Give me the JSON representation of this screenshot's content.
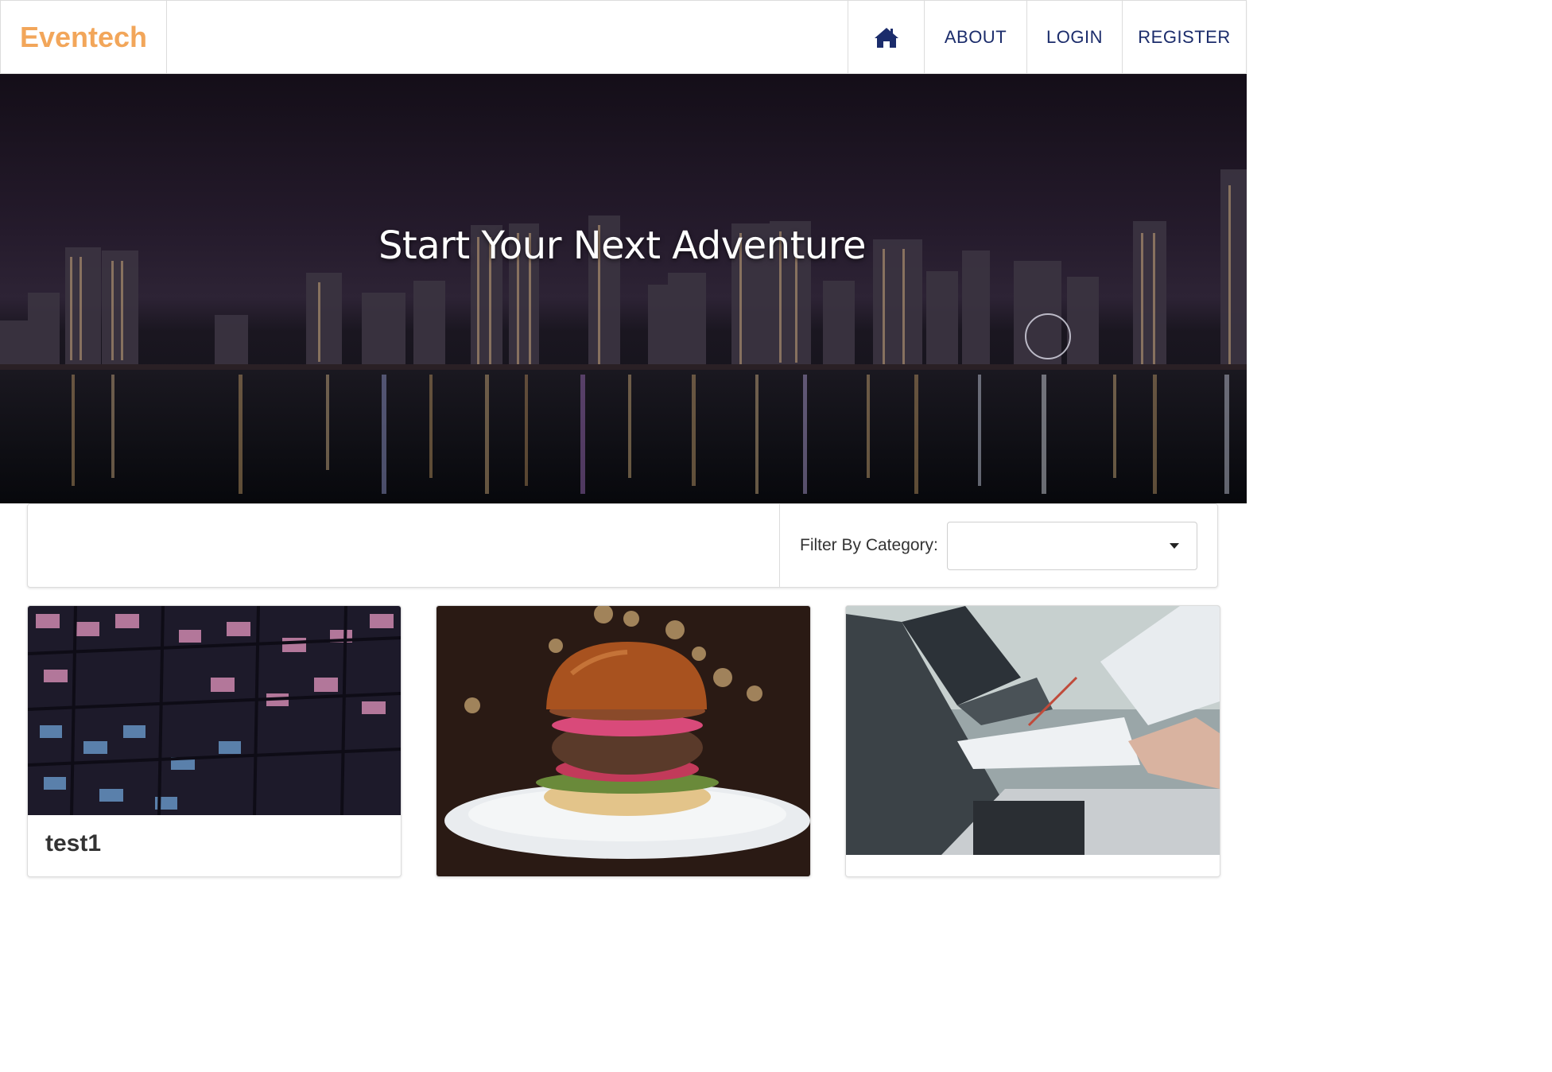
{
  "navbar": {
    "brand": "Eventech",
    "items": [
      {
        "icon": "home-icon"
      },
      {
        "label": "ABOUT"
      },
      {
        "label": "LOGIN"
      },
      {
        "label": "REGISTER"
      }
    ]
  },
  "hero": {
    "title": "Start Your Next Adventure"
  },
  "filter": {
    "label": "Filter By Category:",
    "selected": ""
  },
  "cards": [
    {
      "title": "test1",
      "image": "office-building-night"
    },
    {
      "title": "",
      "image": "burger-plate"
    },
    {
      "title": "",
      "image": "laptops-meeting"
    }
  ],
  "colors": {
    "brand": "#f2a65a",
    "nav_text": "#1b2c6b",
    "border": "#dcdcdc"
  }
}
